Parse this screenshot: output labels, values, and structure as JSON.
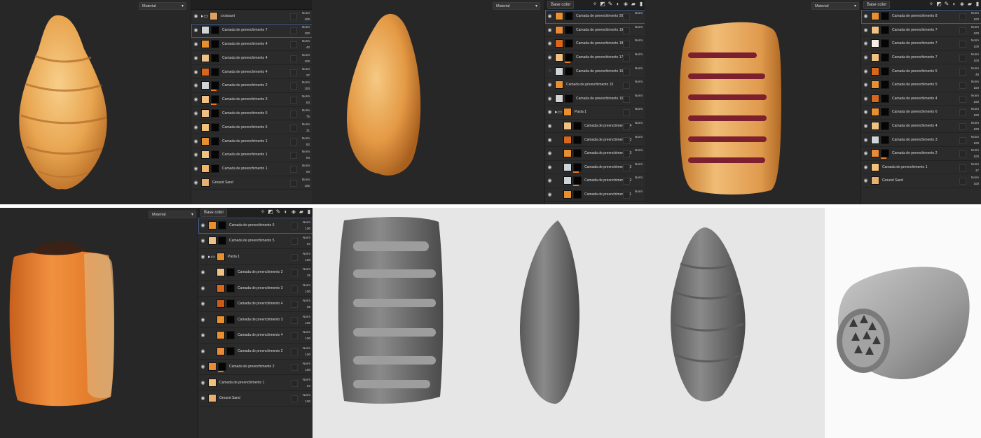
{
  "material_label": "Material",
  "base_color_label": "Base color",
  "blend_label": "Norm",
  "panels": [
    {
      "rows": [
        {
          "name": "croissant",
          "type": "folder",
          "thumb": "#d9a25e",
          "opacity": "100"
        },
        {
          "name": "Camada de preenchimento 7",
          "thumb": "#cfd4d8",
          "opacity": "100",
          "sel": true
        },
        {
          "name": "Camada de preenchimento 4",
          "thumb": "#e8902f",
          "opacity": "42"
        },
        {
          "name": "Camada de preenchimento 4",
          "thumb": "#f0c184",
          "opacity": "100"
        },
        {
          "name": "Camada de preenchimento 4",
          "thumb": "#d8661c",
          "opacity": "37"
        },
        {
          "name": "Camada de preenchimento 2",
          "thumb": "#cfd4d8",
          "opacity": "100",
          "bar": true
        },
        {
          "name": "Camada de preenchimento 3",
          "thumb": "#f0c184",
          "opacity": "63",
          "bar": true
        },
        {
          "name": "Camada de preenchimento 6",
          "thumb": "#f0c184",
          "opacity": "75"
        },
        {
          "name": "Camada de preenchimento 5",
          "thumb": "#f2c27a",
          "opacity": "31"
        },
        {
          "name": "Camada de preenchimento 1",
          "thumb": "#e8902f",
          "opacity": "82"
        },
        {
          "name": "Camada de preenchimento 1",
          "thumb": "#f0c184",
          "opacity": "94"
        },
        {
          "name": "Camada de preenchimento 1",
          "thumb": "#f2b468",
          "opacity": "94"
        },
        {
          "name": "Ground Sand",
          "type": "plain",
          "thumb": "#e8b070",
          "opacity": "100"
        }
      ]
    },
    {
      "rows": [
        {
          "name": "Camada de preenchimento 20",
          "thumb": "#e8902f",
          "opacity": "",
          "sel": true
        },
        {
          "name": "Camada de preenchimento 19",
          "thumb": "#e88a3a",
          "opacity": ""
        },
        {
          "name": "Camada de preenchimento 18",
          "thumb": "#d8661c",
          "opacity": ""
        },
        {
          "name": "Camada de preenchimento 17",
          "thumb": "#f0c184",
          "opacity": "",
          "bar": true
        },
        {
          "name": "Camada de preenchimento 16",
          "thumb": "#cfd4d8",
          "opacity": "",
          "hidden": true
        },
        {
          "name": "Camada de preenchimento 15",
          "type": "plain",
          "thumb": "#e8902f",
          "opacity": ""
        },
        {
          "name": "Camada de preenchimento 10",
          "thumb": "#cfd4d8",
          "opacity": ""
        },
        {
          "name": "Pasta 1",
          "type": "folder",
          "thumb": "#e8902f",
          "opacity": ""
        },
        {
          "name": "Camada de preenchimento 14",
          "thumb": "#f0c184",
          "opacity": "",
          "ind": true
        },
        {
          "name": "Camada de preenchimento 13",
          "thumb": "#d8661c",
          "opacity": "",
          "ind": true
        },
        {
          "name": "Camada de preenchimento 13",
          "thumb": "#e8902f",
          "opacity": "",
          "ind": true
        },
        {
          "name": "Camada de preenchimento 12",
          "thumb": "#cfd4d8",
          "opacity": "",
          "ind": true,
          "bar": true
        },
        {
          "name": "Camada de preenchimento 12",
          "thumb": "#cfd4d8",
          "opacity": "",
          "ind": true,
          "bar": true
        },
        {
          "name": "Camada de preenchimento 11",
          "thumb": "#e8902f",
          "opacity": "",
          "ind": true
        }
      ]
    },
    {
      "rows": [
        {
          "name": "Camada de preenchimento 8",
          "thumb": "#e8902f",
          "opacity": "100",
          "sel": true
        },
        {
          "name": "Camada de preenchimento 7",
          "thumb": "#f0c184",
          "opacity": "100"
        },
        {
          "name": "Camada de preenchimento 7",
          "thumb": "#f6efe8",
          "opacity": "100"
        },
        {
          "name": "Camada de preenchimento 7",
          "thumb": "#f0c184",
          "opacity": "100"
        },
        {
          "name": "Camada de preenchimento 5",
          "thumb": "#d8661c",
          "opacity": "49"
        },
        {
          "name": "Camada de preenchimento 5",
          "thumb": "#e8902f",
          "opacity": "100"
        },
        {
          "name": "Camada de preenchimento 4",
          "thumb": "#d8661c",
          "opacity": "100"
        },
        {
          "name": "Camada de preenchimento 6",
          "thumb": "#e8902f",
          "opacity": "100"
        },
        {
          "name": "Camada de preenchimento 4",
          "thumb": "#f0c184",
          "opacity": "100"
        },
        {
          "name": "Camada de preenchimento 3",
          "thumb": "#cfd4d8",
          "opacity": "100"
        },
        {
          "name": "Camada de preenchimento 2",
          "thumb": "#e88a3a",
          "opacity": "100",
          "bar": true
        },
        {
          "name": "Camada de preenchimento 1",
          "type": "plain",
          "thumb": "#f2c27a",
          "opacity": "37"
        },
        {
          "name": "Ground Sand",
          "type": "plain",
          "thumb": "#e8b070",
          "opacity": "100"
        }
      ]
    },
    {
      "rows": [
        {
          "name": "Camada de preenchimento 6",
          "thumb": "#e8902f",
          "opacity": "100",
          "sel": true
        },
        {
          "name": "Camada de preenchimento 5",
          "thumb": "#f0c184",
          "opacity": "64"
        },
        {
          "name": "Pasta 1",
          "type": "folder",
          "thumb": "#e8902f",
          "opacity": "100"
        },
        {
          "name": "Camada de preenchimento 2",
          "thumb": "#f0c184",
          "opacity": "25",
          "ind": true
        },
        {
          "name": "Camada de preenchimento 3",
          "thumb": "#d8661c",
          "opacity": "100",
          "ind": true
        },
        {
          "name": "Camada de preenchimento 4",
          "thumb": "#c85a1a",
          "opacity": "55",
          "ind": true
        },
        {
          "name": "Camada de preenchimento 3",
          "thumb": "#e8902f",
          "opacity": "100",
          "ind": true
        },
        {
          "name": "Camada de preenchimento 4",
          "thumb": "#e8902f",
          "opacity": "100",
          "ind": true
        },
        {
          "name": "Camada de preenchimento 2",
          "thumb": "#e88a3a",
          "opacity": "100",
          "ind": true
        },
        {
          "name": "Camada de preenchimento 2",
          "thumb": "#e88a3a",
          "opacity": "100",
          "bar": true
        },
        {
          "name": "Camada de preenchimento 1",
          "type": "plain",
          "thumb": "#f2c27a",
          "opacity": "64"
        },
        {
          "name": "Ground Sand",
          "type": "plain",
          "thumb": "#e8b070",
          "opacity": "100"
        }
      ]
    }
  ]
}
